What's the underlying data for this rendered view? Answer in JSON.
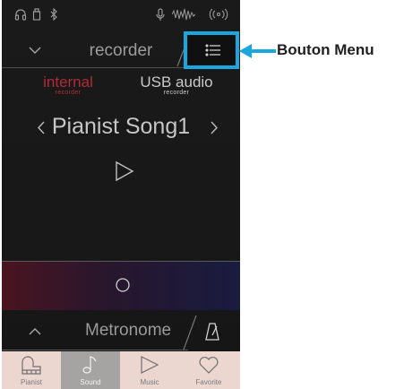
{
  "status_bar": {
    "icons": [
      "headphones-icon",
      "usb-memory-icon",
      "bluetooth-icon",
      "microphone-icon",
      "audio-waveform-icon",
      "wireless-icon"
    ]
  },
  "header": {
    "title": "recorder",
    "collapse_icon": "chevron-down-icon",
    "menu_icon": "list-menu-icon"
  },
  "sources": [
    {
      "label": "internal",
      "sublabel": "recorder",
      "active": true,
      "color": "#b22a35"
    },
    {
      "label": "USB audio",
      "sublabel": "recorder",
      "active": false,
      "color": "#c9c9c9"
    }
  ],
  "song": {
    "name": "Pianist Song1",
    "prev_icon": "chevron-left-icon",
    "next_icon": "chevron-right-icon",
    "play_icon": "play-icon"
  },
  "record_panel": {
    "icon": "record-circle-icon"
  },
  "metronome": {
    "label": "Metronome",
    "expand_icon": "chevron-up-icon",
    "icon": "metronome-icon"
  },
  "tabs": [
    {
      "label": "Pianist",
      "icon": "piano-icon",
      "active": false
    },
    {
      "label": "Sound",
      "icon": "music-note-icon",
      "active": true
    },
    {
      "label": "Music",
      "icon": "play-icon",
      "active": false
    },
    {
      "label": "Favorite",
      "icon": "heart-icon",
      "active": false
    }
  ],
  "callout": {
    "label": "Bouton Menu",
    "color": "#1aa7e0"
  }
}
